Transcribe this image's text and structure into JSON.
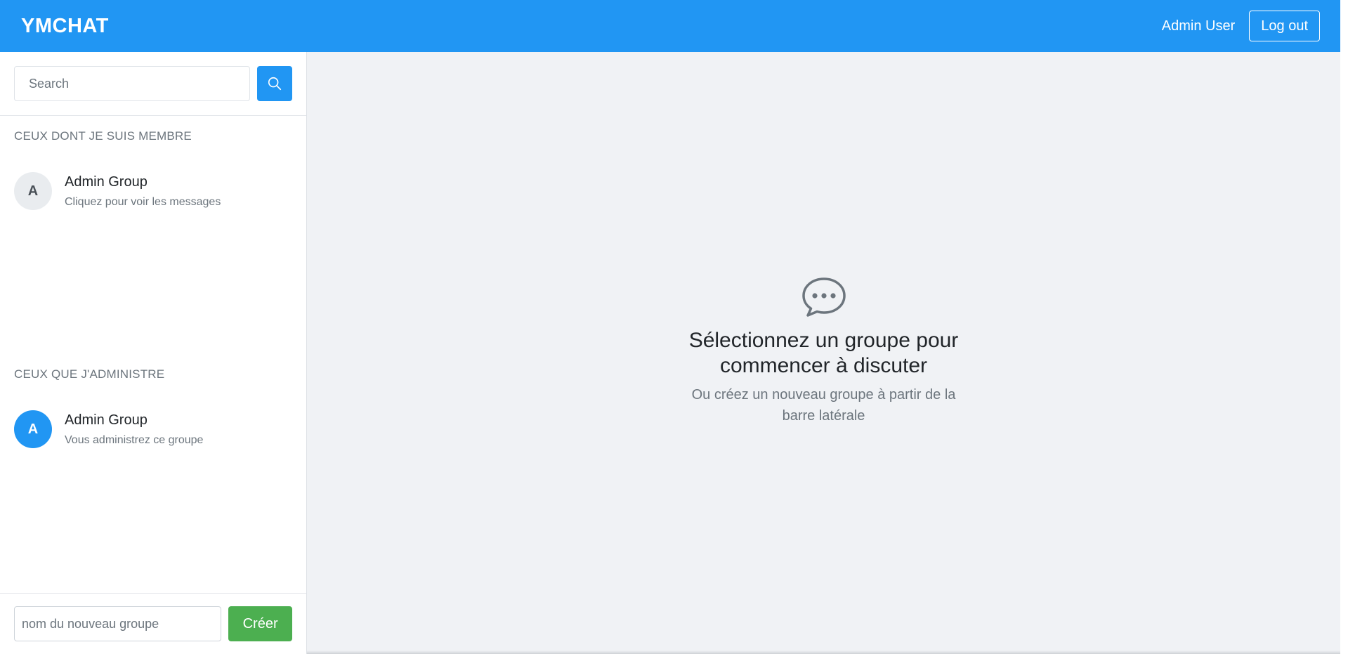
{
  "header": {
    "brand": "YMCHAT",
    "user_name": "Admin User",
    "logout_label": "Log out"
  },
  "sidebar": {
    "search": {
      "placeholder": "Search",
      "value": ""
    },
    "member_section": {
      "title": "CEUX DONT JE SUIS MEMBRE",
      "groups": [
        {
          "initial": "A",
          "name": "Admin Group",
          "subtitle": "Cliquez pour voir les messages"
        }
      ]
    },
    "admin_section": {
      "title": "CEUX QUE J'ADMINISTRE",
      "groups": [
        {
          "initial": "A",
          "name": "Admin Group",
          "subtitle": "Vous administrez ce groupe"
        }
      ]
    },
    "create": {
      "placeholder": "nom du nouveau groupe",
      "value": "",
      "button_label": "Créer"
    }
  },
  "main": {
    "empty_state": {
      "icon": "chat-bubble-icon",
      "title_line1": "Sélectionnez un groupe pour",
      "title_line2": "commencer à discuter",
      "subtitle_line1": "Ou créez un nouveau groupe à partir de la",
      "subtitle_line2": "barre latérale"
    }
  },
  "colors": {
    "primary": "#2196f3",
    "success": "#4caf50",
    "muted_text": "#6c757d",
    "main_background": "#f0f2f5"
  }
}
